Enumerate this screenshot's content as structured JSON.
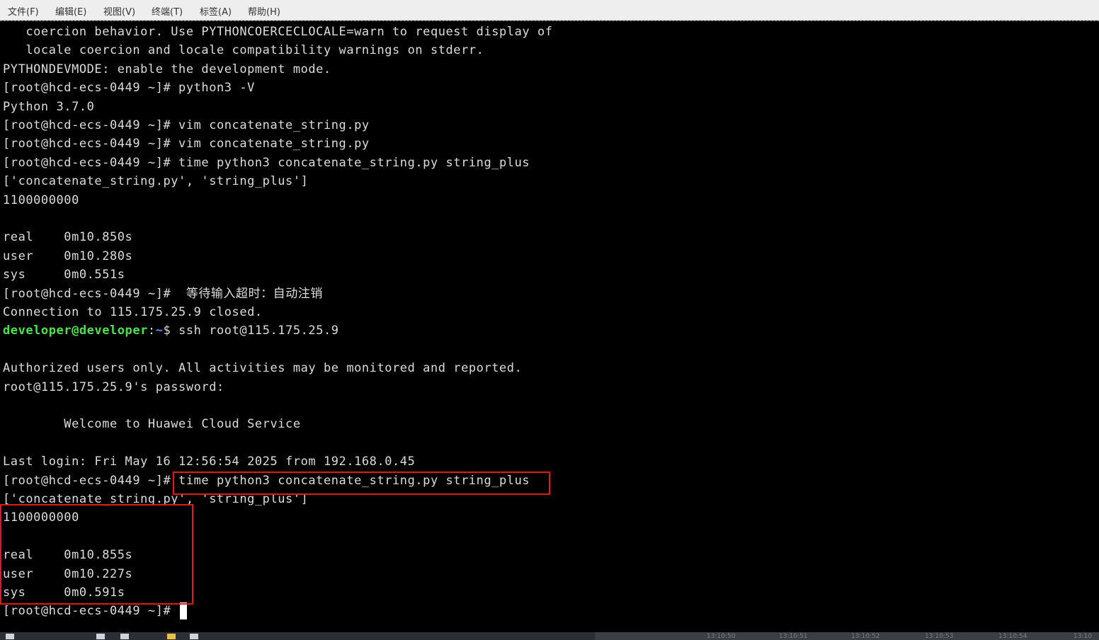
{
  "menu": [
    {
      "label": "文件(F)"
    },
    {
      "label": "编辑(E)"
    },
    {
      "label": "视图(V)"
    },
    {
      "label": "终端(T)"
    },
    {
      "label": "标签(A)"
    },
    {
      "label": "帮助(H)"
    }
  ],
  "terminal": {
    "lines": [
      "   coercion behavior. Use PYTHONCOERCECLOCALE=warn to request display of",
      "   locale coercion and locale compatibility warnings on stderr.",
      "PYTHONDEVMODE: enable the development mode.",
      "[root@hcd-ecs-0449 ~]# python3 -V",
      "Python 3.7.0",
      "[root@hcd-ecs-0449 ~]# vim concatenate_string.py",
      "[root@hcd-ecs-0449 ~]# vim concatenate_string.py",
      "[root@hcd-ecs-0449 ~]# time python3 concatenate_string.py string_plus",
      "['concatenate_string.py', 'string_plus']",
      "1100000000",
      "",
      "real\t0m10.850s",
      "user\t0m10.280s",
      "sys\t0m0.551s",
      "[root@hcd-ecs-0449 ~]#  等待输入超时：自动注销",
      "Connection to 115.175.25.9 closed.",
      "__PROMPT__",
      "",
      "Authorized users only. All activities may be monitored and reported.",
      "root@115.175.25.9's password:",
      "",
      "\tWelcome to Huawei Cloud Service",
      "",
      "Last login: Fri May 16 12:56:54 2025 from 192.168.0.45",
      "[root@hcd-ecs-0449 ~]# time python3 concatenate_string.py string_plus",
      "['concatenate_string.py', 'string_plus']",
      "1100000000",
      "",
      "real\t0m10.855s",
      "user\t0m10.227s",
      "sys\t0m0.591s",
      "__LAST__"
    ],
    "local_prompt": {
      "user_host": "developer@developer",
      "colon": ":",
      "path": "~",
      "suffix": "$ ssh root@115.175.25.9"
    },
    "last_prompt": "[root@hcd-ecs-0449 ~]# "
  },
  "taskbar": {
    "times": [
      "13:10:50",
      "13:10:51",
      "13:10:52",
      "13:10:53",
      "13:10:54",
      "13:10"
    ]
  },
  "colors": {
    "highlight": "#e01818",
    "prompt_user": "#4ee04e",
    "prompt_path": "#5c8cff"
  }
}
